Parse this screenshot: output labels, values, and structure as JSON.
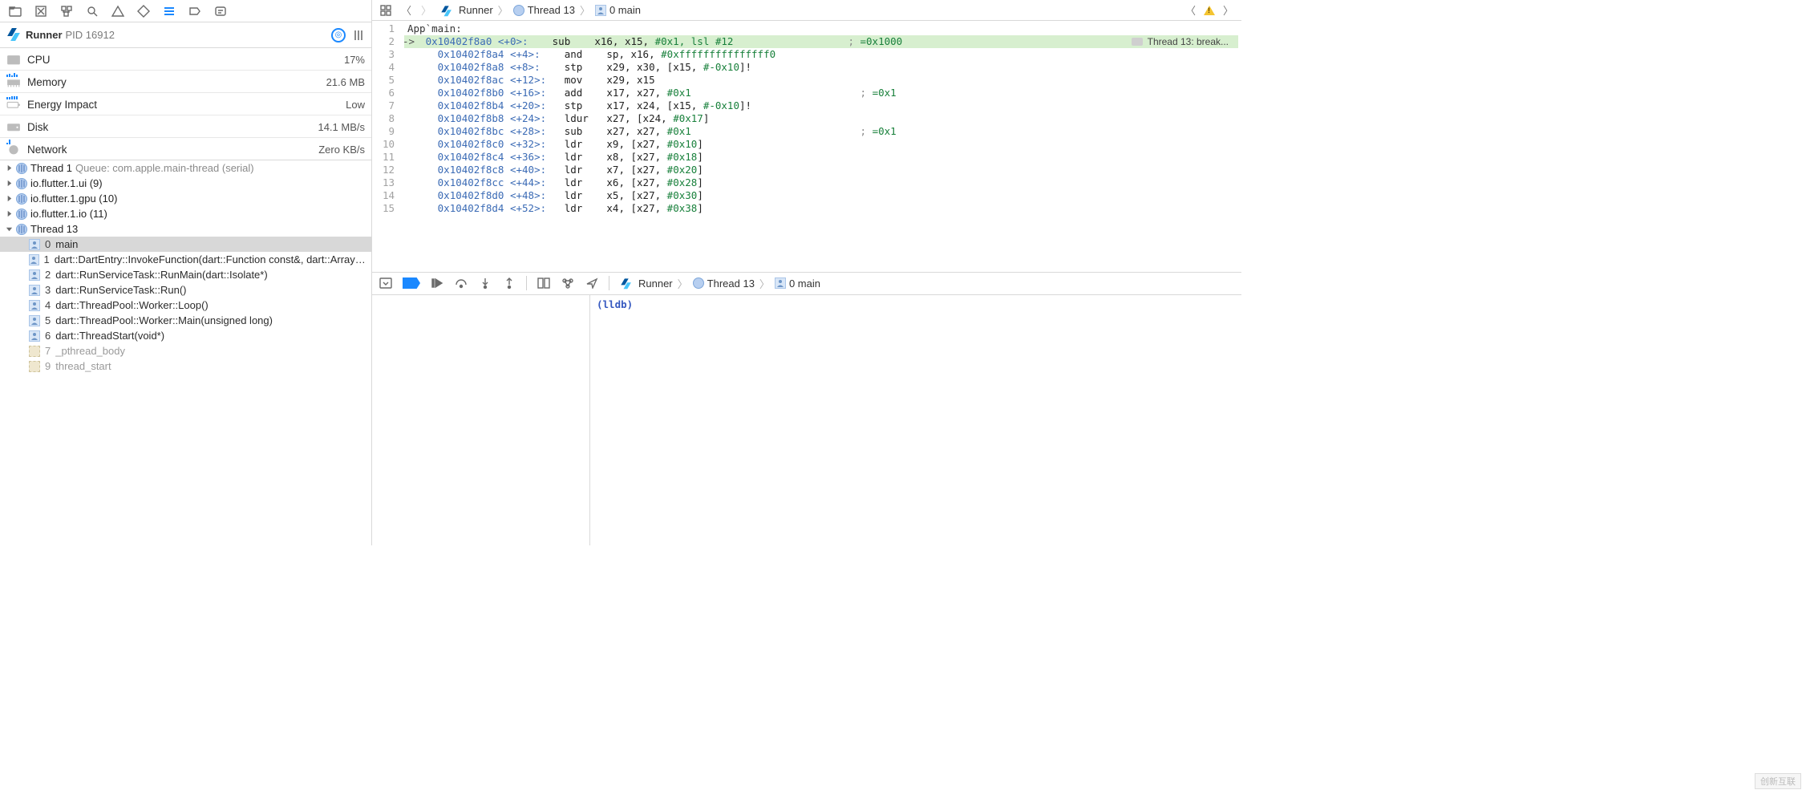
{
  "process": {
    "name": "Runner",
    "pid_label": "PID 16912"
  },
  "stats": {
    "cpu": {
      "label": "CPU",
      "value": "17%"
    },
    "memory": {
      "label": "Memory",
      "value": "21.6 MB"
    },
    "energy": {
      "label": "Energy Impact",
      "value": "Low"
    },
    "disk": {
      "label": "Disk",
      "value": "14.1 MB/s"
    },
    "network": {
      "label": "Network",
      "value": "Zero KB/s"
    }
  },
  "threads": [
    {
      "name": "Thread 1",
      "suffix": "Queue: com.apple.main-thread (serial)",
      "expanded": false
    },
    {
      "name": "io.flutter.1.ui (9)",
      "suffix": "",
      "expanded": false
    },
    {
      "name": "io.flutter.1.gpu (10)",
      "suffix": "",
      "expanded": false
    },
    {
      "name": "io.flutter.1.io (11)",
      "suffix": "",
      "expanded": false
    },
    {
      "name": "Thread 13",
      "suffix": "",
      "expanded": true
    }
  ],
  "frames": [
    {
      "idx": "0",
      "name": "main",
      "kind": "user",
      "selected": true
    },
    {
      "idx": "1",
      "name": "dart::DartEntry::InvokeFunction(dart::Function const&, dart::Array const&, d...",
      "kind": "user"
    },
    {
      "idx": "2",
      "name": "dart::RunServiceTask::RunMain(dart::Isolate*)",
      "kind": "user"
    },
    {
      "idx": "3",
      "name": "dart::RunServiceTask::Run()",
      "kind": "user"
    },
    {
      "idx": "4",
      "name": "dart::ThreadPool::Worker::Loop()",
      "kind": "user"
    },
    {
      "idx": "5",
      "name": "dart::ThreadPool::Worker::Main(unsigned long)",
      "kind": "user"
    },
    {
      "idx": "6",
      "name": "dart::ThreadStart(void*)",
      "kind": "user"
    },
    {
      "idx": "7",
      "name": "_pthread_body",
      "kind": "sys"
    },
    {
      "idx": "9",
      "name": "thread_start",
      "kind": "sys"
    }
  ],
  "breadcrumb_top": {
    "runner": "Runner",
    "thread": "Thread 13",
    "frame": "0 main"
  },
  "disasm": {
    "header": "App`main:",
    "lines": [
      {
        "n": 1,
        "raw_header": true
      },
      {
        "n": 2,
        "arrow": true,
        "hl": true,
        "addr": "0x10402f8a0",
        "off": "<+0>:",
        "mn": "sub",
        "ops": "x16, x15, ",
        "imm": "#0x1, lsl #12",
        "cmt": "; =0x1000"
      },
      {
        "n": 3,
        "addr": "0x10402f8a4",
        "off": "<+4>:",
        "mn": "and",
        "ops": "sp, x16, ",
        "imm": "#0xfffffffffffffff0"
      },
      {
        "n": 4,
        "addr": "0x10402f8a8",
        "off": "<+8>:",
        "mn": "stp",
        "ops": "x29, x30, [x15, ",
        "imm": "#-0x10",
        "tail": "]!"
      },
      {
        "n": 5,
        "addr": "0x10402f8ac",
        "off": "<+12>:",
        "mn": "mov",
        "ops": "x29, x15"
      },
      {
        "n": 6,
        "addr": "0x10402f8b0",
        "off": "<+16>:",
        "mn": "add",
        "ops": "x17, x27, ",
        "imm": "#0x1",
        "cmt": "; =0x1"
      },
      {
        "n": 7,
        "addr": "0x10402f8b4",
        "off": "<+20>:",
        "mn": "stp",
        "ops": "x17, x24, [x15, ",
        "imm": "#-0x10",
        "tail": "]!"
      },
      {
        "n": 8,
        "addr": "0x10402f8b8",
        "off": "<+24>:",
        "mn": "ldur",
        "ops": "x27, [x24, ",
        "imm": "#0x17",
        "tail": "]"
      },
      {
        "n": 9,
        "addr": "0x10402f8bc",
        "off": "<+28>:",
        "mn": "sub",
        "ops": "x27, x27, ",
        "imm": "#0x1",
        "cmt": "; =0x1"
      },
      {
        "n": 10,
        "addr": "0x10402f8c0",
        "off": "<+32>:",
        "mn": "ldr",
        "ops": "x9, [x27, ",
        "imm": "#0x10",
        "tail": "]"
      },
      {
        "n": 11,
        "addr": "0x10402f8c4",
        "off": "<+36>:",
        "mn": "ldr",
        "ops": "x8, [x27, ",
        "imm": "#0x18",
        "tail": "]"
      },
      {
        "n": 12,
        "addr": "0x10402f8c8",
        "off": "<+40>:",
        "mn": "ldr",
        "ops": "x7, [x27, ",
        "imm": "#0x20",
        "tail": "]"
      },
      {
        "n": 13,
        "addr": "0x10402f8cc",
        "off": "<+44>:",
        "mn": "ldr",
        "ops": "x6, [x27, ",
        "imm": "#0x28",
        "tail": "]"
      },
      {
        "n": 14,
        "addr": "0x10402f8d0",
        "off": "<+48>:",
        "mn": "ldr",
        "ops": "x5, [x27, ",
        "imm": "#0x30",
        "tail": "]"
      },
      {
        "n": 15,
        "addr": "0x10402f8d4",
        "off": "<+52>:",
        "mn": "ldr",
        "ops": "x4, [x27, ",
        "imm": "#0x38",
        "tail": "]"
      }
    ],
    "breakpoint_chip": "Thread 13: break..."
  },
  "breadcrumb_debug": {
    "runner": "Runner",
    "thread": "Thread 13",
    "frame": "0 main"
  },
  "console_prompt": "(lldb)",
  "watermark": "创新互联"
}
